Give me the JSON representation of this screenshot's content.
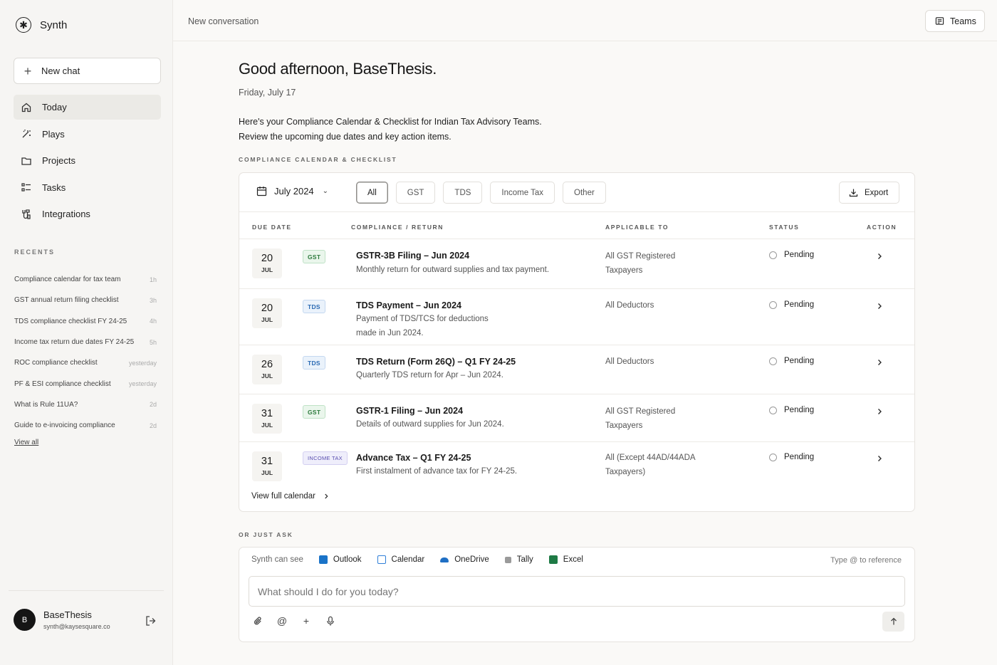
{
  "app": {
    "name": "Synth"
  },
  "sidebar": {
    "new_chat_label": "New chat",
    "nav": [
      {
        "label": "Today",
        "icon": "home-icon",
        "active": true
      },
      {
        "label": "Plays",
        "icon": "magic-wand-icon"
      },
      {
        "label": "Projects",
        "icon": "folder-icon"
      },
      {
        "label": "Tasks",
        "icon": "checklist-icon"
      },
      {
        "label": "Integrations",
        "icon": "integrations-icon"
      }
    ],
    "recents_label": "RECENTS",
    "recents": [
      {
        "title": "Compliance calendar for tax team",
        "time": "1h"
      },
      {
        "title": "GST annual return filing checklist",
        "time": "3h"
      },
      {
        "title": "TDS compliance checklist FY 24-25",
        "time": "4h"
      },
      {
        "title": "Income tax return due dates FY 24-25",
        "time": "5h"
      },
      {
        "title": "ROC compliance checklist",
        "time": "yesterday"
      },
      {
        "title": "PF & ESI compliance checklist",
        "time": "yesterday"
      },
      {
        "title": "What is Rule 11UA?",
        "time": "2d"
      },
      {
        "title": "Guide to e-invoicing compliance",
        "time": "2d"
      }
    ],
    "view_all": "View all",
    "user": {
      "initial": "B",
      "name": "BaseThesis",
      "email": "synth@kaysesquare.co"
    }
  },
  "topbar": {
    "title": "New conversation",
    "teams_label": "Teams"
  },
  "main": {
    "greeting": "Good afternoon, BaseThesis.",
    "date": "Friday, July 17",
    "intro_line1": "Here's your Compliance Calendar & Checklist for Indian Tax Advisory Teams.",
    "intro_line2": "Review the upcoming due dates and key action items.",
    "section_label": "COMPLIANCE CALENDAR & CHECKLIST",
    "month": "July 2024",
    "filters": [
      "All",
      "GST",
      "TDS",
      "Income Tax",
      "Other"
    ],
    "active_filter": "All",
    "export_label": "Export",
    "columns": {
      "due_date": "DUE DATE",
      "compliance": "COMPLIANCE / RETURN",
      "applicable": "APPLICABLE TO",
      "status": "STATUS",
      "action": "ACTION"
    },
    "rows": [
      {
        "day": "20",
        "month": "JUL",
        "tag": "GST",
        "tag_type": "gst",
        "title": "GSTR-3B Filing – Jun 2024",
        "desc": "Monthly return for outward supplies and tax payment.",
        "applies": "All GST Registered Taxpayers",
        "status": "Pending"
      },
      {
        "day": "20",
        "month": "JUL",
        "tag": "TDS",
        "tag_type": "tds",
        "title": "TDS Payment – Jun 2024",
        "desc": "Payment of TDS/TCS for deductions made in Jun 2024.",
        "applies": "All Deductors",
        "status": "Pending"
      },
      {
        "day": "26",
        "month": "JUL",
        "tag": "TDS",
        "tag_type": "tds",
        "title": "TDS Return (Form 26Q) – Q1 FY 24-25",
        "desc": "Quarterly TDS return for Apr – Jun 2024.",
        "applies": "All Deductors",
        "status": "Pending"
      },
      {
        "day": "31",
        "month": "JUL",
        "tag": "GST",
        "tag_type": "gst",
        "title": "GSTR-1 Filing – Jun 2024",
        "desc": "Details of outward supplies for Jun 2024.",
        "applies": "All GST Registered Taxpayers",
        "status": "Pending"
      },
      {
        "day": "31",
        "month": "JUL",
        "tag": "INCOME TAX",
        "tag_type": "itax",
        "title": "Advance Tax – Q1 FY 24-25",
        "desc": "First instalment of advance tax for FY 24-25.",
        "applies": "All (Except 44AD/44ADA Taxpayers)",
        "status": "Pending"
      }
    ],
    "view_full_calendar": "View full calendar"
  },
  "ask": {
    "section_label": "OR JUST ASK",
    "synth_can_see": "Synth can see",
    "sources": [
      {
        "label": "Outlook",
        "color": "#1a73c8"
      },
      {
        "label": "Calendar",
        "color": "#2f7fd8"
      },
      {
        "label": "OneDrive",
        "color": "#1f6fc4"
      },
      {
        "label": "Tally",
        "color": "#777777"
      },
      {
        "label": "Excel",
        "color": "#1e7a45"
      }
    ],
    "reference_hint": "Type @ to reference",
    "placeholder": "What should I do for you today?"
  }
}
